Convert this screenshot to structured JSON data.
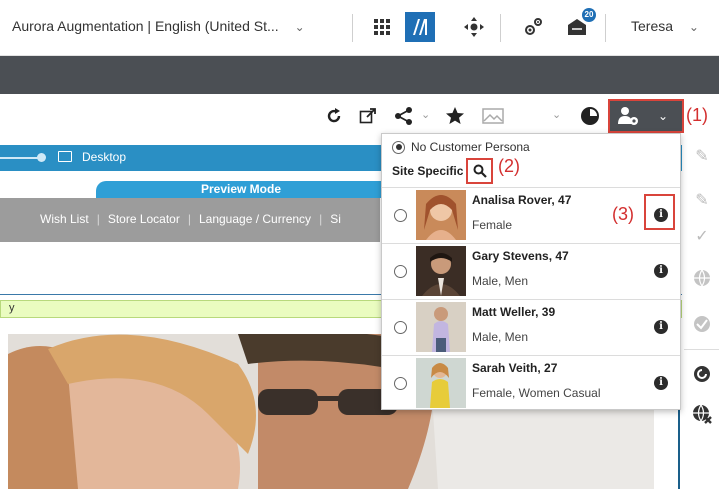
{
  "topbar": {
    "site_selector": "Aurora Augmentation | English (United St...",
    "user_name": "Teresa",
    "notification_count": "20"
  },
  "toolbar": {
    "icons": [
      "refresh-icon",
      "external-link-icon",
      "share-icon",
      "star-icon",
      "image-icon",
      "clock-icon",
      "persona-icon"
    ]
  },
  "preview": {
    "device_label": "Desktop",
    "mode_label": "Preview Mode",
    "nav_links": [
      "Wish List",
      "Store Locator",
      "Language / Currency",
      "Si"
    ],
    "green_text": "y"
  },
  "dropdown": {
    "no_persona_label": "No Customer Persona",
    "site_specific_label": "Site Specific",
    "personas": [
      {
        "name": "Analisa Rover, 47",
        "attributes": "Female"
      },
      {
        "name": "Gary Stevens, 47",
        "attributes": "Male, Men"
      },
      {
        "name": "Matt Weller, 39",
        "attributes": "Male, Men"
      },
      {
        "name": "Sarah Veith, 27",
        "attributes": "Female, Women Casual"
      }
    ]
  },
  "callouts": {
    "c1": "(1)",
    "c2": "(2)",
    "c3": "(3)"
  },
  "colors": {
    "accent_blue": "#1f6fb5",
    "dark_bar": "#4b4f54",
    "highlight_red": "#d9443b",
    "device_bar": "#2a8fc4",
    "preview_tab": "#2f9fd6"
  }
}
